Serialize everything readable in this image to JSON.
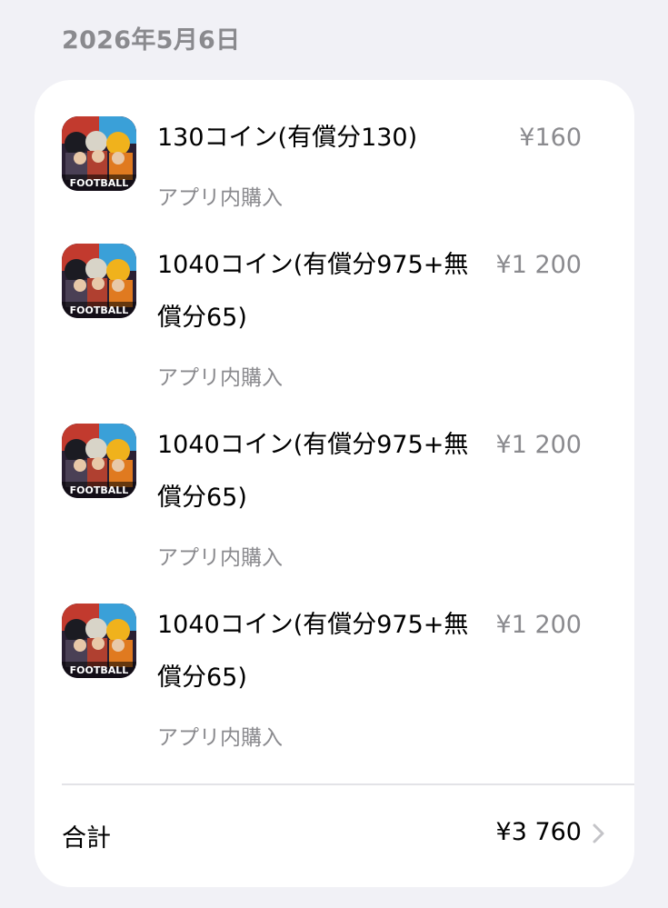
{
  "date_header": "2026年5月6日",
  "items": [
    {
      "title": "130コイン(有償分130)",
      "subtitle": "アプリ内購入",
      "price": "¥160",
      "icon": "efootball-app-icon"
    },
    {
      "title": "1040コイン(有償分975+無償分65)",
      "subtitle": "アプリ内購入",
      "price": "¥1 200",
      "icon": "efootball-app-icon"
    },
    {
      "title": "1040コイン(有償分975+無償分65)",
      "subtitle": "アプリ内購入",
      "price": "¥1 200",
      "icon": "efootball-app-icon"
    },
    {
      "title": "1040コイン(有償分975+無償分65)",
      "subtitle": "アプリ内購入",
      "price": "¥1 200",
      "icon": "efootball-app-icon"
    }
  ],
  "total": {
    "label": "合計",
    "value": "¥3 760",
    "icon": "chevron-right-icon"
  },
  "icon_text": "FOOTBALL",
  "colors": {
    "background": "#f1f1f6",
    "card": "#ffffff",
    "secondary_text": "#8a8a8e",
    "primary_text": "#000000"
  }
}
